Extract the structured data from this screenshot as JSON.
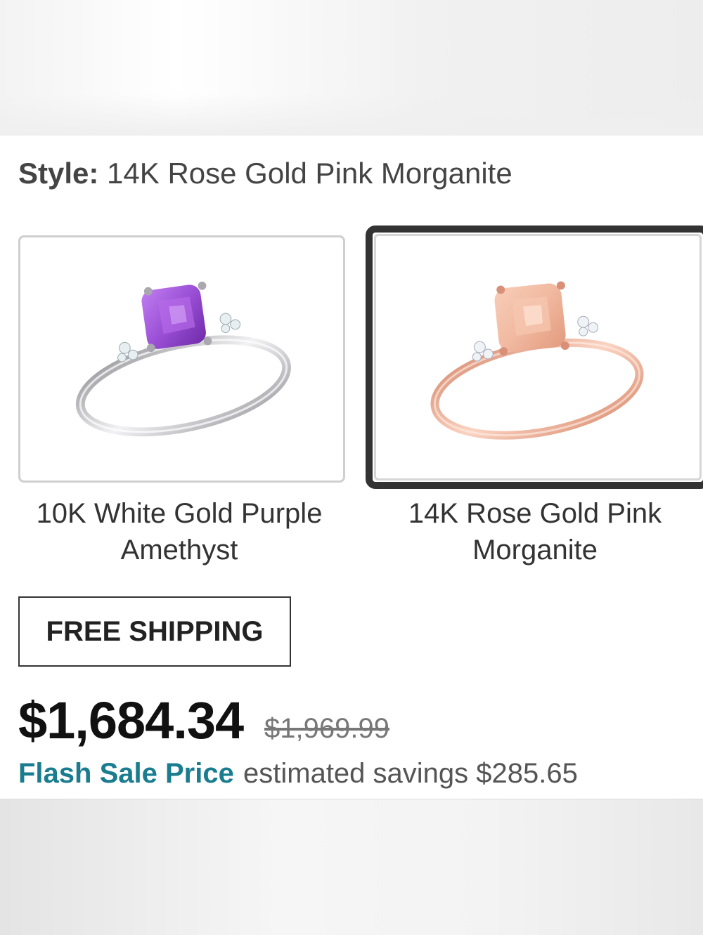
{
  "style": {
    "label": "Style:",
    "value": "14K Rose Gold Pink Morganite"
  },
  "swatches": [
    {
      "caption": "10K White Gold Purple Amethyst",
      "gem_color": "#9b4fd6",
      "band_color": "#c8c8cc",
      "selected": false
    },
    {
      "caption": "14K Rose Gold Pink Morganite",
      "gem_color": "#f1b9a0",
      "band_color": "#e8a48a",
      "selected": true
    }
  ],
  "shipping": {
    "label": "FREE SHIPPING"
  },
  "pricing": {
    "sale_price": "$1,684.34",
    "original_price": "$1,969.99",
    "flash_label": "Flash Sale Price",
    "savings_text": "estimated savings $285.65"
  },
  "colors": {
    "accent_teal": "#1a7d8f",
    "selected_border": "#333333"
  }
}
